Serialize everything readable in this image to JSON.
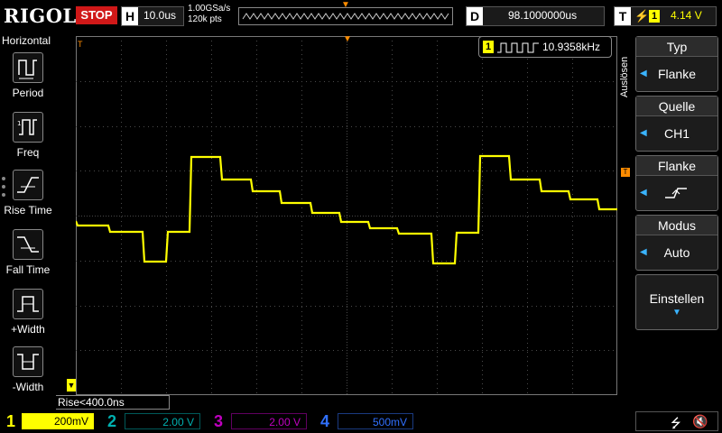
{
  "top": {
    "logo": "RIGOL",
    "run_state": "STOP",
    "horizontal_letter": "H",
    "timebase": "10.0us",
    "sample_rate": "1.00GSa/s",
    "memory_depth": "120k pts",
    "delay_letter": "D",
    "delay": "98.1000000us",
    "trigger_letter": "T",
    "trigger_channel": "1",
    "trigger_level": "4.14 V"
  },
  "left_menu": {
    "title": "Horizontal",
    "items": [
      {
        "label": "Period",
        "icon": "period-icon"
      },
      {
        "label": "Freq",
        "icon": "frequency-icon"
      },
      {
        "label": "Rise Time",
        "icon": "rise-time-icon"
      },
      {
        "label": "Fall Time",
        "icon": "fall-time-icon"
      },
      {
        "label": "+Width",
        "icon": "positive-width-icon"
      },
      {
        "label": "-Width",
        "icon": "negative-width-icon"
      }
    ]
  },
  "measurement": {
    "channel": "1",
    "frequency": "10.9358kHz",
    "rise_time": "Rise<400.0ns"
  },
  "right_menu": {
    "vertical_label": "Auslösen",
    "panels": [
      {
        "header": "Typ",
        "value": "Flanke"
      },
      {
        "header": "Quelle",
        "value": "CH1"
      },
      {
        "header": "Flanke",
        "value": ""
      },
      {
        "header": "Modus",
        "value": "Auto"
      },
      {
        "header": "Einstellen",
        "value": ""
      }
    ]
  },
  "channels": [
    {
      "num": "1",
      "scale": "200mV",
      "color": "#ffff00"
    },
    {
      "num": "2",
      "scale": "2.00 V",
      "color": "#00b0b0"
    },
    {
      "num": "3",
      "scale": "2.00 V",
      "color": "#c000c0"
    },
    {
      "num": "4",
      "scale": "500mV",
      "color": "#3070ff"
    }
  ],
  "colors": {
    "trace": "#ffff00",
    "trigger_marker": "#ff8c00",
    "menu_arrow": "#3ab4ff"
  }
}
